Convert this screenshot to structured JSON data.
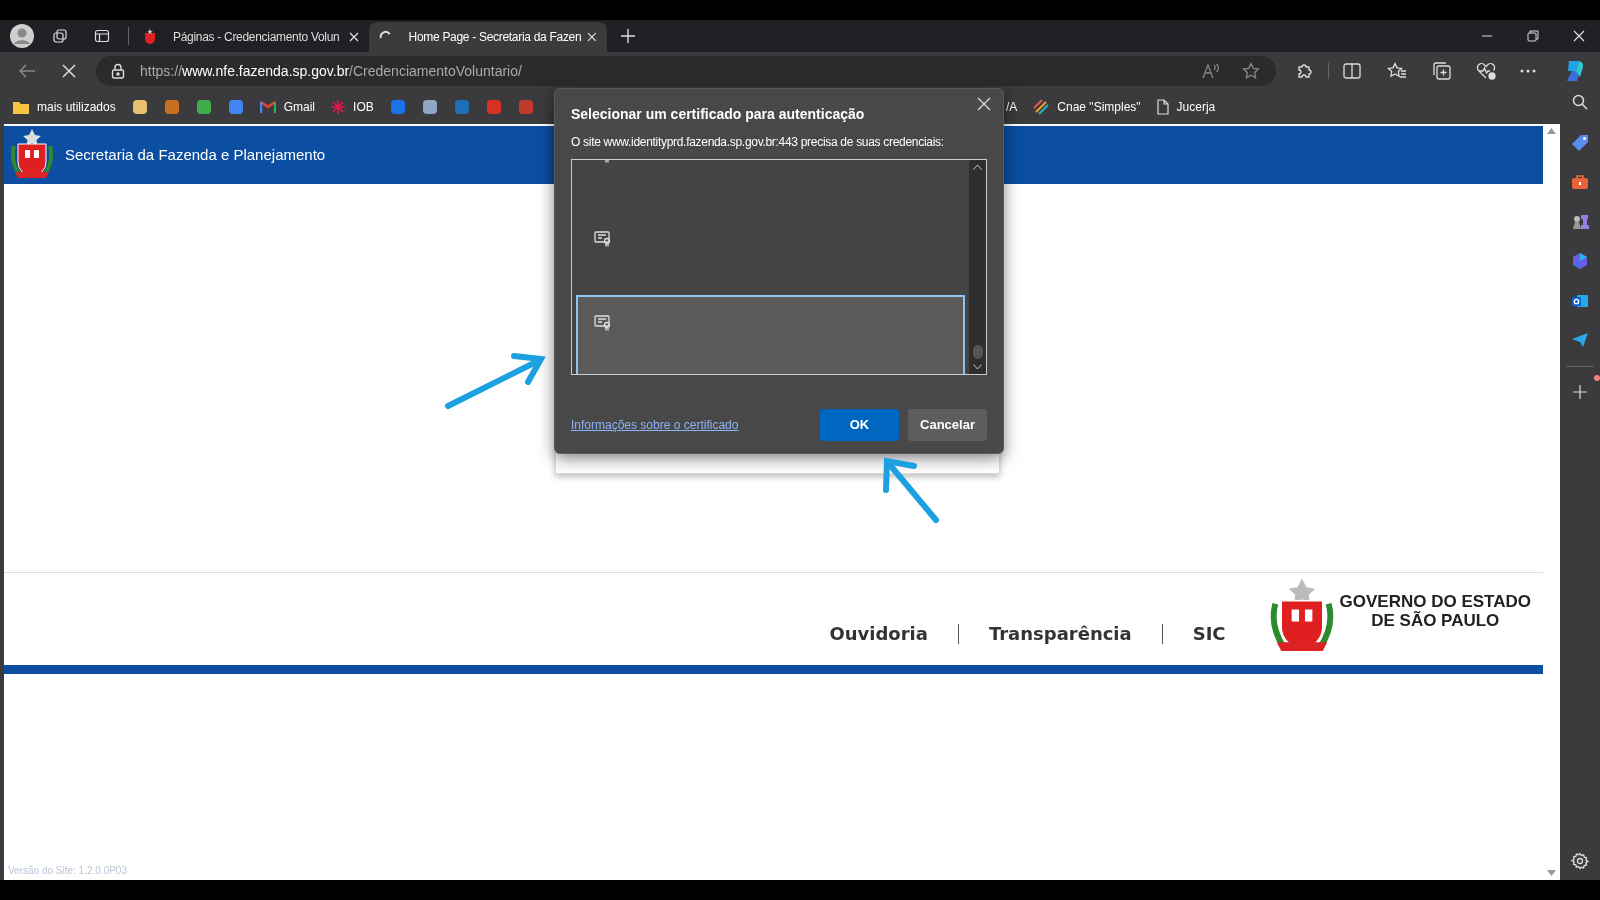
{
  "browser": {
    "tabs": [
      {
        "title": "Páginas - Credenciamento Volun",
        "selected": false,
        "loading": false
      },
      {
        "title": "Home Page - Secretaria da Fazen",
        "selected": true,
        "loading": true
      }
    ],
    "address": {
      "scheme": "https://",
      "host": "www.nfe.fazenda.sp.gov.br",
      "path": "/CredenciamentoVoluntario/"
    },
    "bookmarks": [
      {
        "kind": "folder",
        "label": "mais utilizados"
      },
      {
        "kind": "icon",
        "color": "#e8c170"
      },
      {
        "kind": "icon",
        "color": "#c8701e"
      },
      {
        "kind": "icon",
        "color": "#3fae49"
      },
      {
        "kind": "icon",
        "color": "#4285f4"
      },
      {
        "kind": "gmail",
        "label": "Gmail"
      },
      {
        "kind": "star",
        "label": "IOB"
      },
      {
        "kind": "icon",
        "color": "#1a73e8"
      },
      {
        "kind": "icon",
        "color": "#8fa8c8"
      },
      {
        "kind": "icon",
        "color": "#1d6fb8"
      },
      {
        "kind": "icon",
        "color": "#d93025"
      },
      {
        "kind": "icon",
        "color": "#c0392b"
      },
      {
        "kind": "text",
        "label": "/A"
      },
      {
        "kind": "stripes",
        "label": "Cnae \"Simples\""
      },
      {
        "kind": "page",
        "label": "Jucerja"
      }
    ]
  },
  "page": {
    "header_title": "Secretaria da Fazenda e Planejamento",
    "footer_links": [
      "Ouvidoria",
      "Transparência",
      "SIC"
    ],
    "government": [
      "GOVERNO DO ESTADO",
      "DE SÃO PAULO"
    ],
    "version": "Versão do Site: 1.2.0.0P03"
  },
  "dialog": {
    "title": "Selecionar um certificado para autenticação",
    "message": "O site www.identityprd.fazenda.sp.gov.br:443 precisa de suas credenciais:",
    "certificates": [
      {
        "selected": false
      },
      {
        "selected": false
      },
      {
        "selected": true
      }
    ],
    "link": "Informações sobre o certificado",
    "buttons": [
      {
        "label": "OK",
        "primary": true
      },
      {
        "label": "Cancelar",
        "primary": false
      }
    ]
  }
}
